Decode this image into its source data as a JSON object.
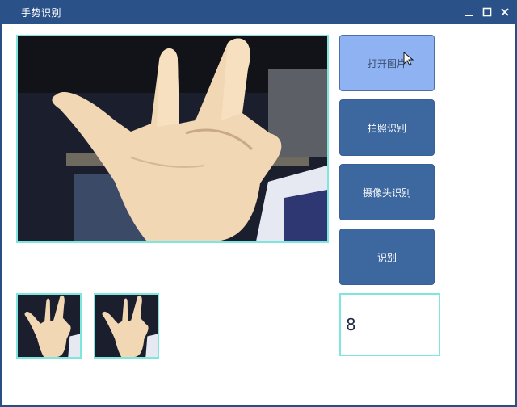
{
  "window": {
    "title": "手势识别"
  },
  "buttons": {
    "open_image": "打开图片",
    "photo_recognize": "拍照识别",
    "camera_recognize": "摄像头识别",
    "recognize": "识别"
  },
  "result": {
    "value": "8"
  },
  "icons": {
    "minimize": "minimize-icon",
    "maximize": "maximize-icon",
    "close": "close-icon",
    "cursor": "mouse-cursor-icon"
  },
  "colors": {
    "title_bar": "#2b5189",
    "button": "#3d679f",
    "button_active": "#8fb3f2",
    "frame_border": "#7fe6df"
  }
}
